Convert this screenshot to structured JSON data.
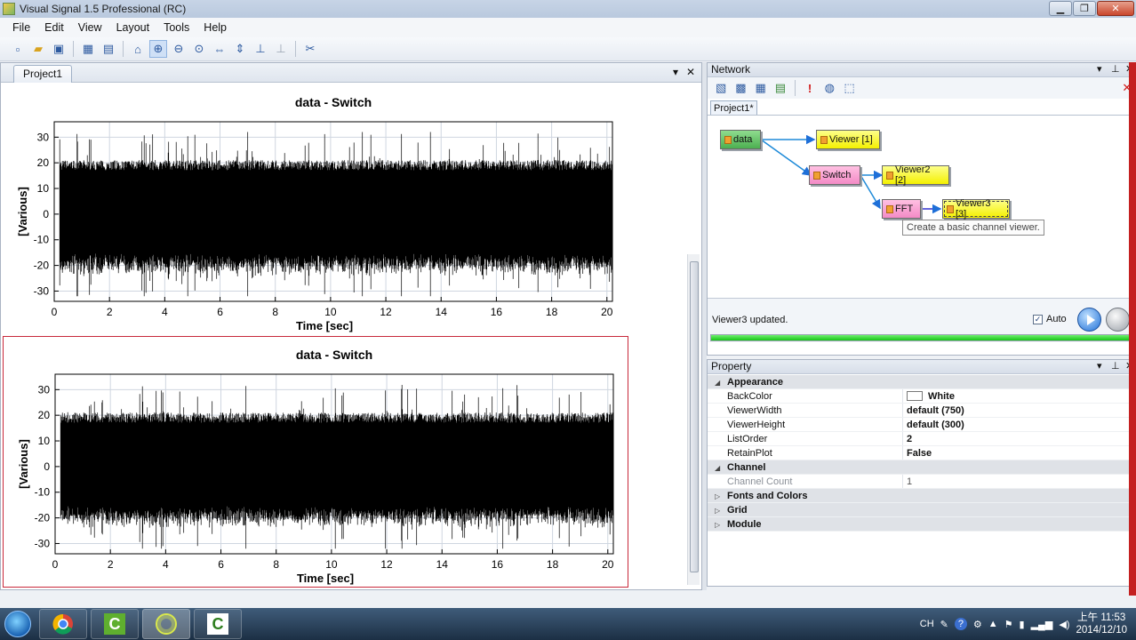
{
  "window": {
    "title": "Visual Signal 1.5 Professional (RC)",
    "min_icon": "minimize-icon",
    "max_icon": "maximize-icon",
    "close_glyph": "✕",
    "min_glyph": "▁",
    "max_glyph": "❐"
  },
  "menu": [
    "File",
    "Edit",
    "View",
    "Layout",
    "Tools",
    "Help"
  ],
  "toolbar": {
    "icons": [
      "new-icon",
      "open-icon",
      "save-icon",
      "layout-icon",
      "layout2-icon",
      "home-icon",
      "zoom-icon",
      "zoom-out-icon",
      "zoom-fit-icon",
      "zoom-x-icon",
      "zoom-y-icon",
      "axis-icon",
      "axis2-icon",
      "tools-icon"
    ]
  },
  "document": {
    "tab": "Project1",
    "dropdown_glyph": "▾",
    "close_glyph": "✕"
  },
  "plots": [
    {
      "title": "data - Switch",
      "xlabel": "Time [sec]",
      "ylabel": "[Various]"
    },
    {
      "title": "data - Switch",
      "xlabel": "Time [sec]",
      "ylabel": "[Various]"
    }
  ],
  "chart_data": [
    {
      "type": "line",
      "title": "data - Switch",
      "xlabel": "Time [sec]",
      "ylabel": "[Various]",
      "xlim": [
        0,
        20.2
      ],
      "ylim": [
        -34,
        36
      ],
      "xticks": [
        0,
        2,
        4,
        6,
        8,
        10,
        12,
        14,
        16,
        18,
        20
      ],
      "yticks": [
        -30,
        -20,
        -10,
        0,
        10,
        20,
        30
      ],
      "grid": true,
      "series": [
        {
          "color": "#000000",
          "envelope": {
            "start": 0.2,
            "end": 20.2,
            "typical_amplitude": 18,
            "peak_amplitude": 32
          }
        }
      ]
    },
    {
      "type": "line",
      "title": "data - Switch",
      "xlabel": "Time [sec]",
      "ylabel": "[Various]",
      "xlim": [
        0,
        20.2
      ],
      "ylim": [
        -34,
        36
      ],
      "xticks": [
        0,
        2,
        4,
        6,
        8,
        10,
        12,
        14,
        16,
        18,
        20
      ],
      "yticks": [
        -30,
        -20,
        -10,
        0,
        10,
        20,
        30
      ],
      "grid": true,
      "series": [
        {
          "color": "#000000",
          "envelope": {
            "start": 0.2,
            "end": 20.2,
            "typical_amplitude": 18,
            "peak_amplitude": 32
          }
        }
      ]
    }
  ],
  "network": {
    "title": "Network",
    "tab": "Project1*",
    "nodes": {
      "data": "data",
      "viewer1": "Viewer [1]",
      "switch": "Switch",
      "viewer2": "Viewer2 [2]",
      "fft": "FFT",
      "viewer3": "Viewer3 [3]"
    },
    "tooltip": "Create a basic channel viewer.",
    "status": "Viewer3 updated.",
    "auto_label": "Auto",
    "auto_checked": "✓",
    "progress": 1.0
  },
  "property": {
    "title": "Property",
    "categories": {
      "appearance": "Appearance",
      "channel": "Channel",
      "fonts": "Fonts and Colors",
      "grid": "Grid",
      "module": "Module"
    },
    "rows": {
      "backcolor": {
        "key": "BackColor",
        "value": "White"
      },
      "viewerwidth": {
        "key": "ViewerWidth",
        "value": "default (750)"
      },
      "viewerheight": {
        "key": "ViewerHeight",
        "value": "default (300)"
      },
      "listorder": {
        "key": "ListOrder",
        "value": "2"
      },
      "retainplot": {
        "key": "RetainPlot",
        "value": "False"
      },
      "channelcount": {
        "key": "Channel Count",
        "value": "1"
      }
    },
    "expanded_glyph": "◢",
    "collapsed_glyph": "▷"
  },
  "taskbar": {
    "lang": "CH",
    "time": "上午 11:53",
    "date": "2014/12/10"
  },
  "colors": {
    "accent": "#1f6fd6",
    "selection": "#c8283a",
    "progress": "#16c416"
  }
}
